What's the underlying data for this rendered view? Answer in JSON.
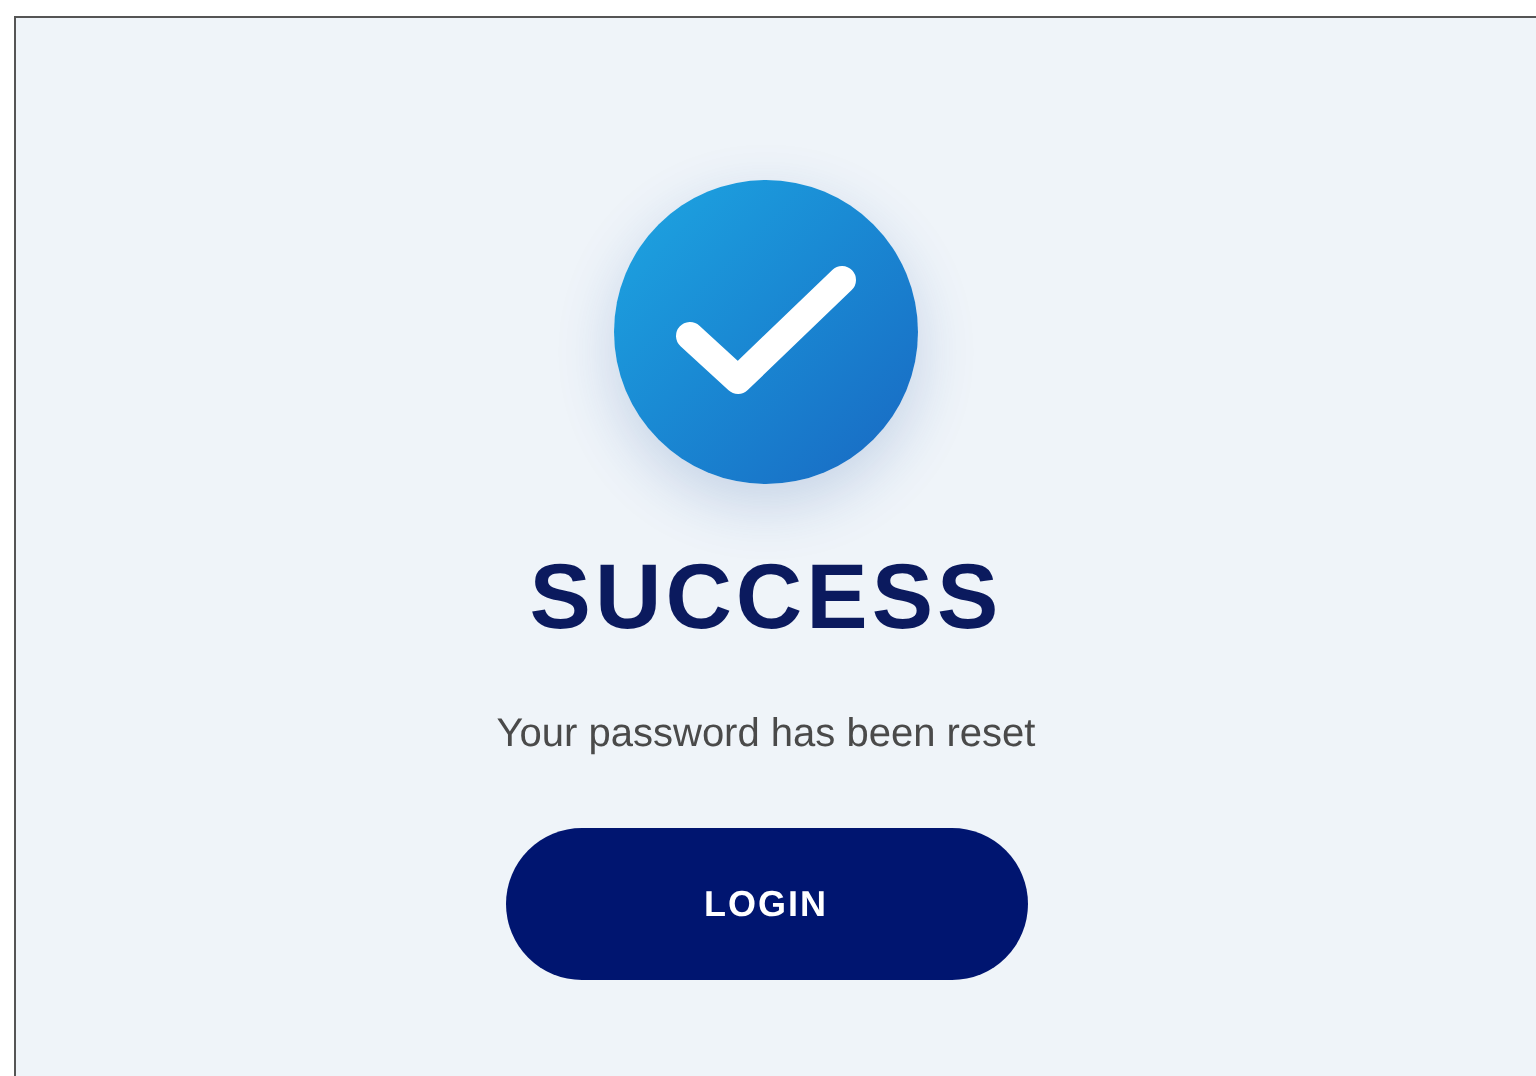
{
  "status": {
    "kind": "success"
  },
  "title": "SUCCESS",
  "message": "Your password has been reset",
  "button": "LOGIN"
}
